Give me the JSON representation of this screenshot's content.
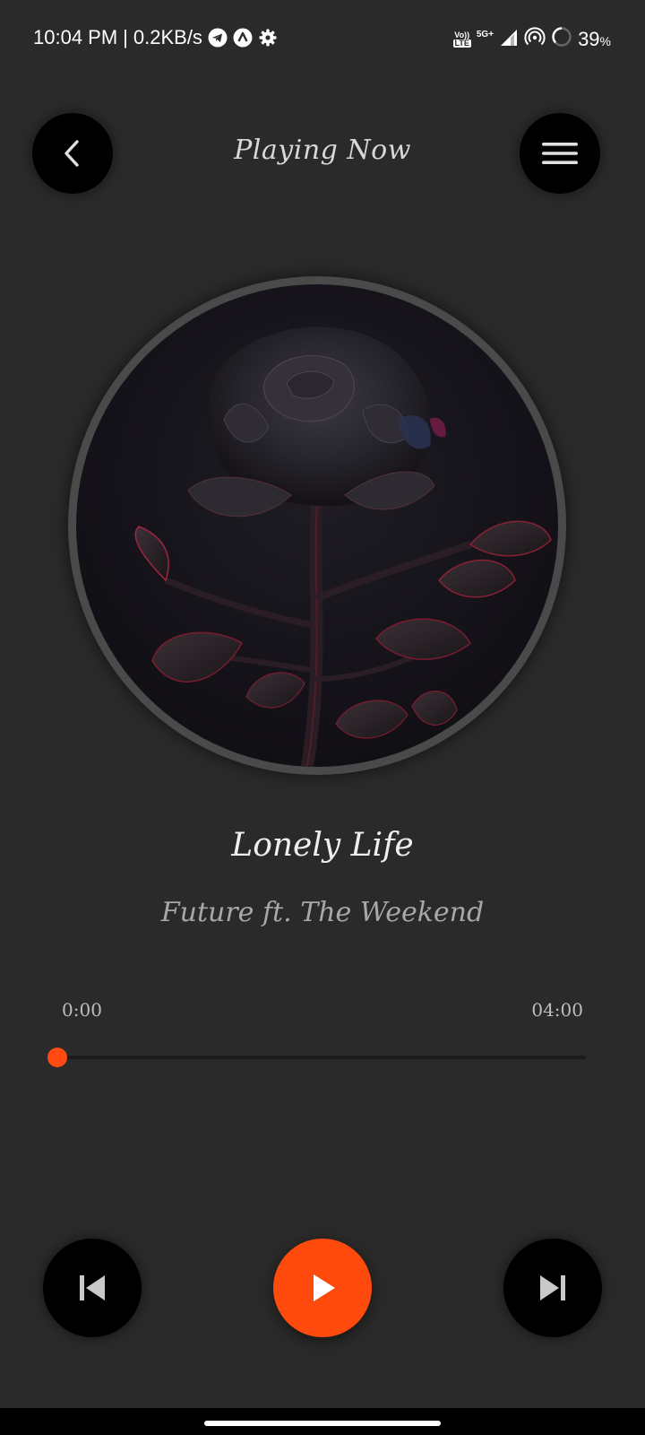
{
  "status_bar": {
    "time": "10:04 PM",
    "separator": "|",
    "net_speed": "0.2KB/s",
    "icons_left": [
      "telegram-icon",
      "app-a-icon",
      "settings-gear-icon"
    ],
    "volte_top": "Vo))",
    "volte_bottom": "LTE",
    "network_type": "5G+",
    "battery_percent": "39",
    "battery_symbol": "%"
  },
  "header": {
    "title": "Playing Now"
  },
  "track": {
    "title": "Lonely Life",
    "artist": "Future ft. The Weekend"
  },
  "progress": {
    "current_time": "0:00",
    "total_time": "04:00",
    "fraction": 0.0
  },
  "colors": {
    "accent": "#ff4a12",
    "background": "#2a2a2a",
    "button": "#000000"
  }
}
